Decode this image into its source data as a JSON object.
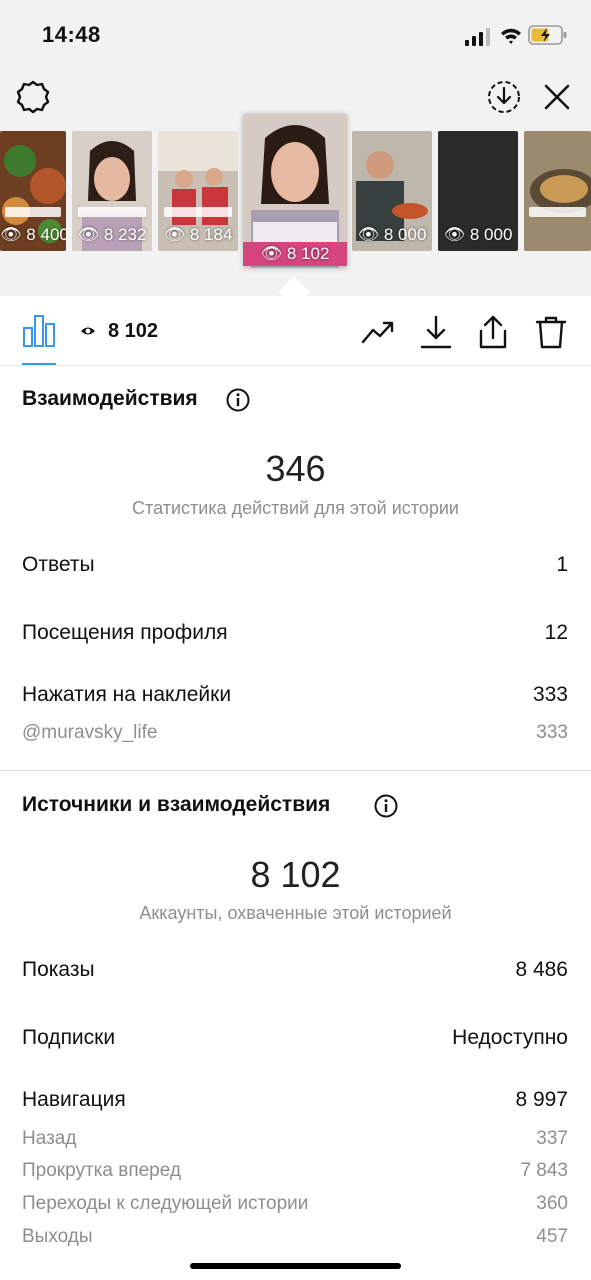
{
  "status_bar": {
    "time": "14:48"
  },
  "stories": [
    {
      "views": "8 400",
      "bg": "#7a4a2a"
    },
    {
      "views": "8 232",
      "bg": "#c9b5a6"
    },
    {
      "views": "8 184",
      "bg": "#b9a58f"
    },
    {
      "views": "8 102",
      "bg": "#c7b2a4"
    },
    {
      "views": "8 000",
      "bg": "#6b6a63"
    },
    {
      "views": "8 000",
      "bg": "#2a2a2a"
    },
    {
      "views": "",
      "bg": "#8b7a5e"
    }
  ],
  "toolbar": {
    "views": "8 102"
  },
  "interactions": {
    "title": "Взаимодействия",
    "total": "346",
    "subtitle": "Статистика действий для этой истории",
    "rows": [
      {
        "label": "Ответы",
        "value": "1"
      },
      {
        "label": "Посещения профиля",
        "value": "12"
      },
      {
        "label": "Нажатия на наклейки",
        "value": "333"
      }
    ],
    "sticker": {
      "label": "@muravsky_life",
      "value": "333"
    }
  },
  "discovery": {
    "title": "Источники и взаимодействия",
    "total": "8 102",
    "subtitle": "Аккаунты, охваченные этой историей",
    "rows": [
      {
        "label": "Показы",
        "value": "8 486"
      },
      {
        "label": "Подписки",
        "value": "Недоступно"
      },
      {
        "label": "Навигация",
        "value": "8 997"
      }
    ],
    "navigation": [
      {
        "label": "Назад",
        "value": "337"
      },
      {
        "label": "Прокрутка вперед",
        "value": "7 843"
      },
      {
        "label": "Переходы к следующей истории",
        "value": "360"
      },
      {
        "label": "Выходы",
        "value": "457"
      }
    ]
  },
  "colors": {
    "accent": "#3897f0",
    "active_views_bg": "#d7457f",
    "muted": "#8e8e8e"
  }
}
